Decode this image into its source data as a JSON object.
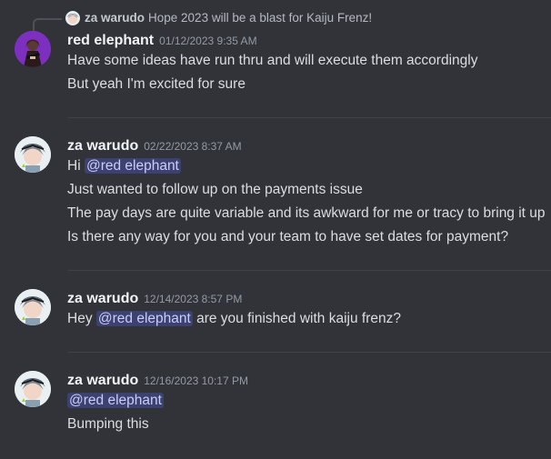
{
  "reply": {
    "author": "za warudo",
    "text": "Hope 2023 will be a blast for Kaiju Frenz!"
  },
  "messages": [
    {
      "author": "red elephant",
      "timestamp": "01/12/2023 9:35 AM",
      "lines": [
        "Have some ideas have run thru and will execute them accordingly",
        "But yeah I'm excited for sure"
      ]
    },
    {
      "author": "za warudo",
      "timestamp": "02/22/2023 8:37 AM",
      "line1_prefix": "Hi ",
      "mention": "@red elephant",
      "lines": [
        "Just wanted to follow up on the payments issue",
        "The pay days are quite variable and its awkward for me or tracy to bring it up",
        "Is there any way for you and your team to have set dates for payment?"
      ]
    },
    {
      "author": "za warudo",
      "timestamp": "12/14/2023 8:57 PM",
      "line1_prefix": "Hey ",
      "mention": "@red elephant",
      "line1_suffix": " are you finished with kaiju frenz?"
    },
    {
      "author": "za warudo",
      "timestamp": "12/16/2023 10:17 PM",
      "mention": "@red elephant",
      "lines": [
        "Bumping this"
      ]
    }
  ]
}
